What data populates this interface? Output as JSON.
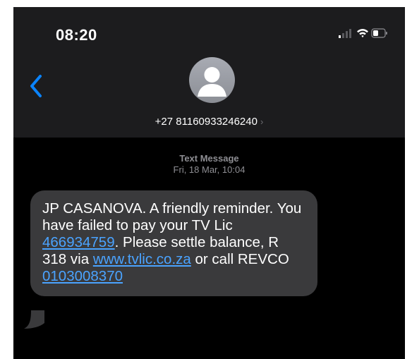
{
  "status_bar": {
    "time": "08:20"
  },
  "header": {
    "contact_number": "+27 81160933246240"
  },
  "thread": {
    "kind": "Text Message",
    "date": "Fri, 18 Mar, 10:04"
  },
  "message": {
    "p1": "JP CASANOVA. A friendly reminder. You have failed to pay your TV Lic ",
    "link_ref": "466934759",
    "p2": ". Please settle balance, R 318 via ",
    "link_url": "www.tvlic.co.za",
    "p3": " or call REVCO ",
    "link_phone": "0103008370"
  },
  "colors": {
    "accent": "#0a84ff",
    "bubble": "#3a3a3c",
    "link": "#4aa3ff"
  },
  "icons": [
    "signal-icon",
    "wifi-icon",
    "battery-icon",
    "back-chevron-icon",
    "person-silhouette-icon",
    "chevron-right-icon"
  ]
}
